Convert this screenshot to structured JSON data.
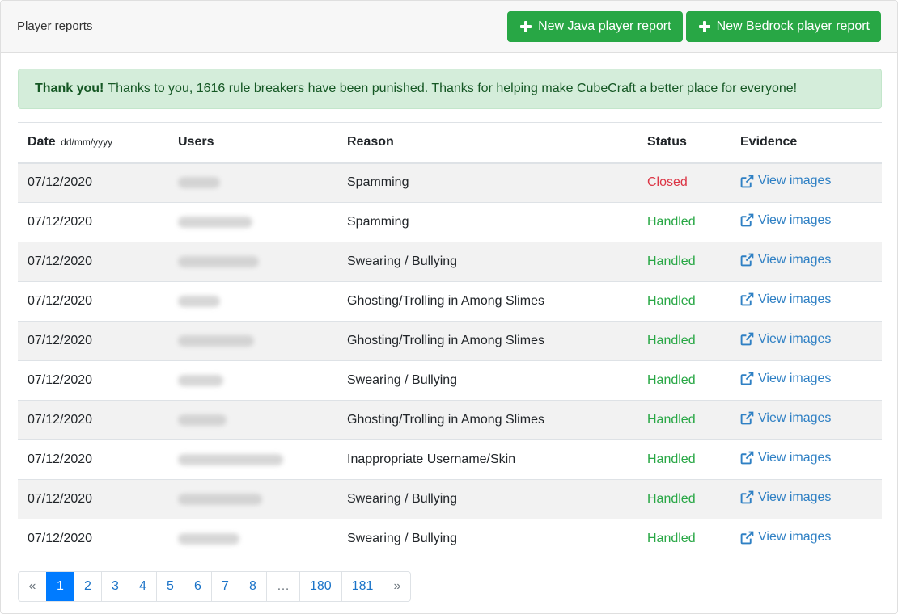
{
  "header": {
    "title": "Player reports",
    "java_button": "New Java player report",
    "bedrock_button": "New Bedrock player report"
  },
  "alert": {
    "strong": "Thank you!",
    "text": "Thanks to you, 1616 rule breakers have been punished. Thanks for helping make CubeCraft a better place for everyone!"
  },
  "table": {
    "headers": {
      "date": "Date",
      "date_format": "dd/mm/yyyy",
      "users": "Users",
      "reason": "Reason",
      "status": "Status",
      "evidence": "Evidence"
    },
    "rows": [
      {
        "date": "07/12/2020",
        "reason": "Spamming",
        "status": "Closed",
        "evidence": "View images"
      },
      {
        "date": "07/12/2020",
        "reason": "Spamming",
        "status": "Handled",
        "evidence": "View images"
      },
      {
        "date": "07/12/2020",
        "reason": "Swearing / Bullying",
        "status": "Handled",
        "evidence": "View images"
      },
      {
        "date": "07/12/2020",
        "reason": "Ghosting/Trolling in Among Slimes",
        "status": "Handled",
        "evidence": "View images"
      },
      {
        "date": "07/12/2020",
        "reason": "Ghosting/Trolling in Among Slimes",
        "status": "Handled",
        "evidence": "View images"
      },
      {
        "date": "07/12/2020",
        "reason": "Swearing / Bullying",
        "status": "Handled",
        "evidence": "View images"
      },
      {
        "date": "07/12/2020",
        "reason": "Ghosting/Trolling in Among Slimes",
        "status": "Handled",
        "evidence": "View images"
      },
      {
        "date": "07/12/2020",
        "reason": "Inappropriate Username/Skin",
        "status": "Handled",
        "evidence": "View images"
      },
      {
        "date": "07/12/2020",
        "reason": "Swearing / Bullying",
        "status": "Handled",
        "evidence": "View images"
      },
      {
        "date": "07/12/2020",
        "reason": "Swearing / Bullying",
        "status": "Handled",
        "evidence": "View images"
      }
    ]
  },
  "colors": {
    "closed": "#dc3545",
    "handled": "#28a745",
    "link": "#2f80c4",
    "button": "#28a745",
    "active_page": "#007bff"
  },
  "pagination": {
    "pages": [
      "«",
      "1",
      "2",
      "3",
      "4",
      "5",
      "6",
      "7",
      "8",
      "…",
      "180",
      "181",
      "»"
    ],
    "active": "1"
  }
}
